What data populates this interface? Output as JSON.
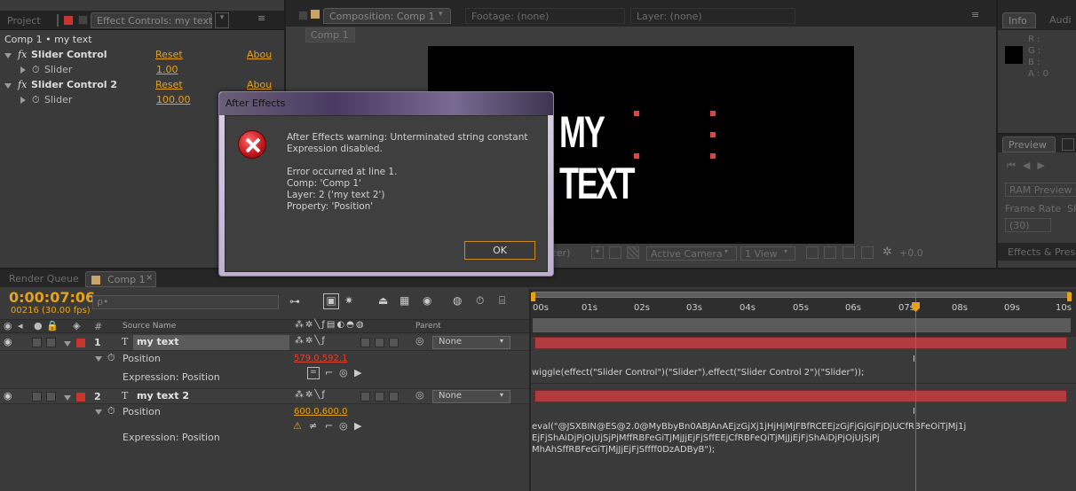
{
  "project_panel": {
    "tab_project": "Project",
    "tab_effect_controls": "Effect Controls: my text",
    "breadcrumb": "Comp 1 • my text",
    "effects": [
      {
        "name": "Slider Control",
        "reset": "Reset",
        "about": "Abou",
        "param": "Slider",
        "value": "1.00"
      },
      {
        "name": "Slider Control 2",
        "reset": "Reset",
        "about": "Abou",
        "param": "Slider",
        "value": "100.00"
      }
    ]
  },
  "comp_panel": {
    "tab_composition": "Composition: Comp 1",
    "tab_footage": "Footage: (none)",
    "tab_layer": "Layer: (none)",
    "sub_tab": "Comp 1",
    "preview_text": "MY TEXT",
    "bottom_partial": "rter)",
    "camera": "Active Camera",
    "view": "1 View",
    "exposure": "+0.0"
  },
  "info_panel": {
    "tab_info": "Info",
    "tab_audio": "Audi",
    "r": "R :",
    "g": "G :",
    "b": "B :",
    "a": "A : 0"
  },
  "preview_panel": {
    "tab": "Preview",
    "ram_preview": "RAM Preview O",
    "frame_rate_label": "Frame Rate",
    "frame_rate_partial": "Sk",
    "frame_rate_value": "(30)",
    "effects_tab": "Effects & Prese"
  },
  "dialog": {
    "title": "After Effects",
    "message": "After Effects warning: Unterminated string constant\nExpression disabled.\n\nError occurred at line 1.\nComp: 'Comp 1'\nLayer: 2 ('my text 2')\nProperty: 'Position'",
    "ok": "OK"
  },
  "timeline": {
    "tab_render_queue": "Render Queue",
    "tab_comp": "Comp 1",
    "timecode": "0:00:07:06",
    "frame_info": "00216 (30.00 fps)",
    "search_placeholder": "ρ•",
    "col_hash": "#",
    "col_source_name": "Source Name",
    "col_parent": "Parent",
    "ruler": [
      "00s",
      "01s",
      "02s",
      "03s",
      "04s",
      "05s",
      "06s",
      "07s",
      "08s",
      "09s",
      "10s"
    ],
    "layers": [
      {
        "num": "1",
        "name": "my text",
        "parent": "None",
        "prop": "Position",
        "value": "579.0,592.1",
        "expr_label": "Expression: Position",
        "expression": "wiggle(effect(\"Slider Control\")(\"Slider\"),effect(\"Slider Control 2\")(\"Slider\"));"
      },
      {
        "num": "2",
        "name": "my text 2",
        "parent": "None",
        "prop": "Position",
        "value": "600.0,600.0",
        "expr_label": "Expression: Position",
        "expression_lines": [
          "eval(\"@JSXBIN@ES@2.0@MyBbyBn0ABJAnAEjzGjXj1jHjHjMjFBfRCEEjzGjFjGjGjFjDjUCfRBFeOiTjMj1j",
          "EjFjShAiDjPjOjUjSjPjMffRBFeGiTjMjJjEjFjSffEEjCfRBFeQiTjMjJjEjFjShAiDjPjOjUjSjPj",
          "MhAhSffRBFeGiTjMjJjEjFjSffff0DzADByB\");"
        ]
      }
    ]
  },
  "colors": {
    "accent_orange": "#e8a21a",
    "label_red": "#c8352d",
    "error_red": "#e0432e",
    "bar_red": "#a8383a"
  }
}
